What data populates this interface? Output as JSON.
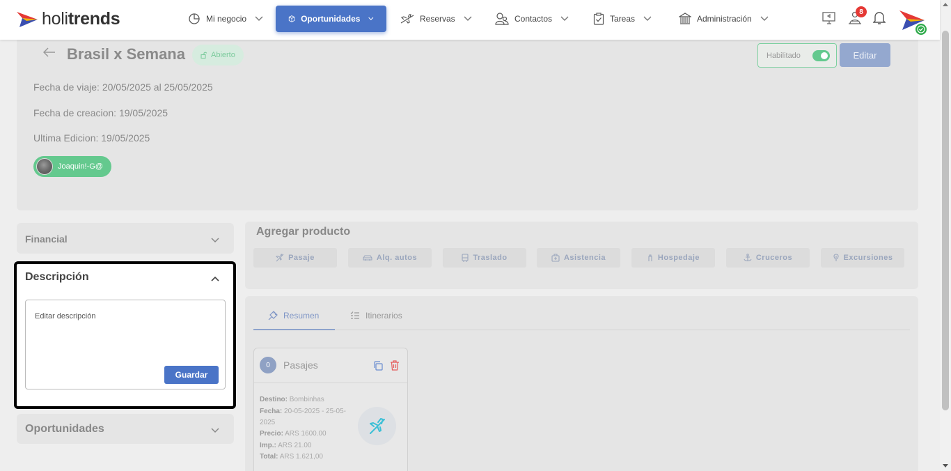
{
  "brand": {
    "logo_light": "holi",
    "logo_bold": "trends"
  },
  "nav": {
    "items": [
      {
        "label": "Mi negocio",
        "icon": "pie-chart-icon"
      },
      {
        "label": "Oportunidades",
        "icon": "cube-icon",
        "active": true
      },
      {
        "label": "Reservas",
        "icon": "plane-icon"
      },
      {
        "label": "Contactos",
        "icon": "users-icon"
      },
      {
        "label": "Tareas",
        "icon": "clipboard-check-icon"
      },
      {
        "label": "Administración",
        "icon": "bank-icon"
      }
    ],
    "notification_count": "8"
  },
  "header": {
    "title": "Brasil x Semana",
    "status": "Abierto",
    "fecha_viaje": "Fecha de viaje: 20/05/2025 al 25/05/2025",
    "fecha_creacion": "Fecha de creacion: 19/05/2025",
    "ultima_edicion": "Ultima Edicion: 19/05/2025",
    "user_chip": "Joaquin!-G@",
    "toggle_label": "Habilitado",
    "toggle_on": true,
    "edit_label": "Editar"
  },
  "sidebar": {
    "financial_title": "Financial",
    "description_title": "Descripción",
    "description_placeholder": "Editar descripción",
    "save_label": "Guardar",
    "opportunities_title": "Oportunidades"
  },
  "products": {
    "title": "Agregar producto",
    "buttons": [
      {
        "label": "Pasaje",
        "icon": "plane-icon"
      },
      {
        "label": "Alq. autos",
        "icon": "car-icon"
      },
      {
        "label": "Traslado",
        "icon": "bus-icon"
      },
      {
        "label": "Asistencia",
        "icon": "medkit-icon"
      },
      {
        "label": "Hospedaje",
        "icon": "hotel-icon"
      },
      {
        "label": "Cruceros",
        "icon": "anchor-icon"
      },
      {
        "label": "Excursiones",
        "icon": "balloon-icon"
      }
    ]
  },
  "summary": {
    "tabs": [
      {
        "label": "Resumen",
        "icon": "pin-icon",
        "active": true
      },
      {
        "label": "Itinerarios",
        "icon": "list-icon",
        "active": false
      }
    ],
    "pasaje": {
      "count": "0",
      "title": "Pasajes",
      "destino_label": "Destino:",
      "destino_value": " Bombinhas",
      "fecha_label": "Fecha:",
      "fecha_value": " 20-05-2025 - 25-05-2025",
      "precio_label": "Precio:",
      "precio_value": " ARS 1600.00",
      "imp_label": "Imp.:",
      "imp_value": " ARS 21.00",
      "total_label": "Total:",
      "total_value": " ARS 1.621,00"
    }
  },
  "colors": {
    "primary": "#4a74c7",
    "success": "#64c98e",
    "danger": "#e53935",
    "accent_plane": "#3bbfd6"
  }
}
